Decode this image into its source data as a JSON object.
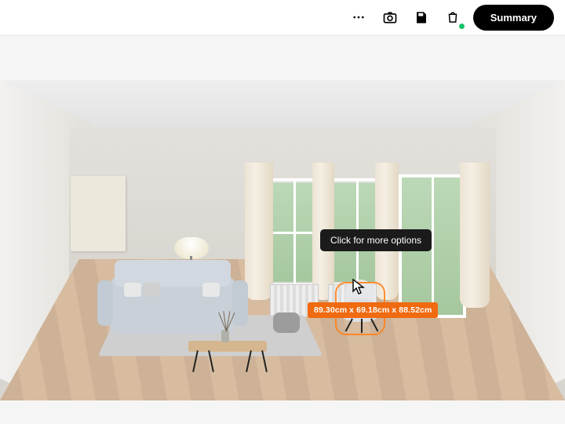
{
  "toolbar": {
    "more_label": "More",
    "camera_label": "Screenshot",
    "save_label": "Save",
    "bag_label": "Shopping bag",
    "summary_label": "Summary"
  },
  "scene": {
    "tooltip_text": "Click for more options",
    "selected_item": {
      "name": "lounge-chair",
      "dimensions_text": "89.30cm x 69.18cm x 88.52cm"
    }
  }
}
